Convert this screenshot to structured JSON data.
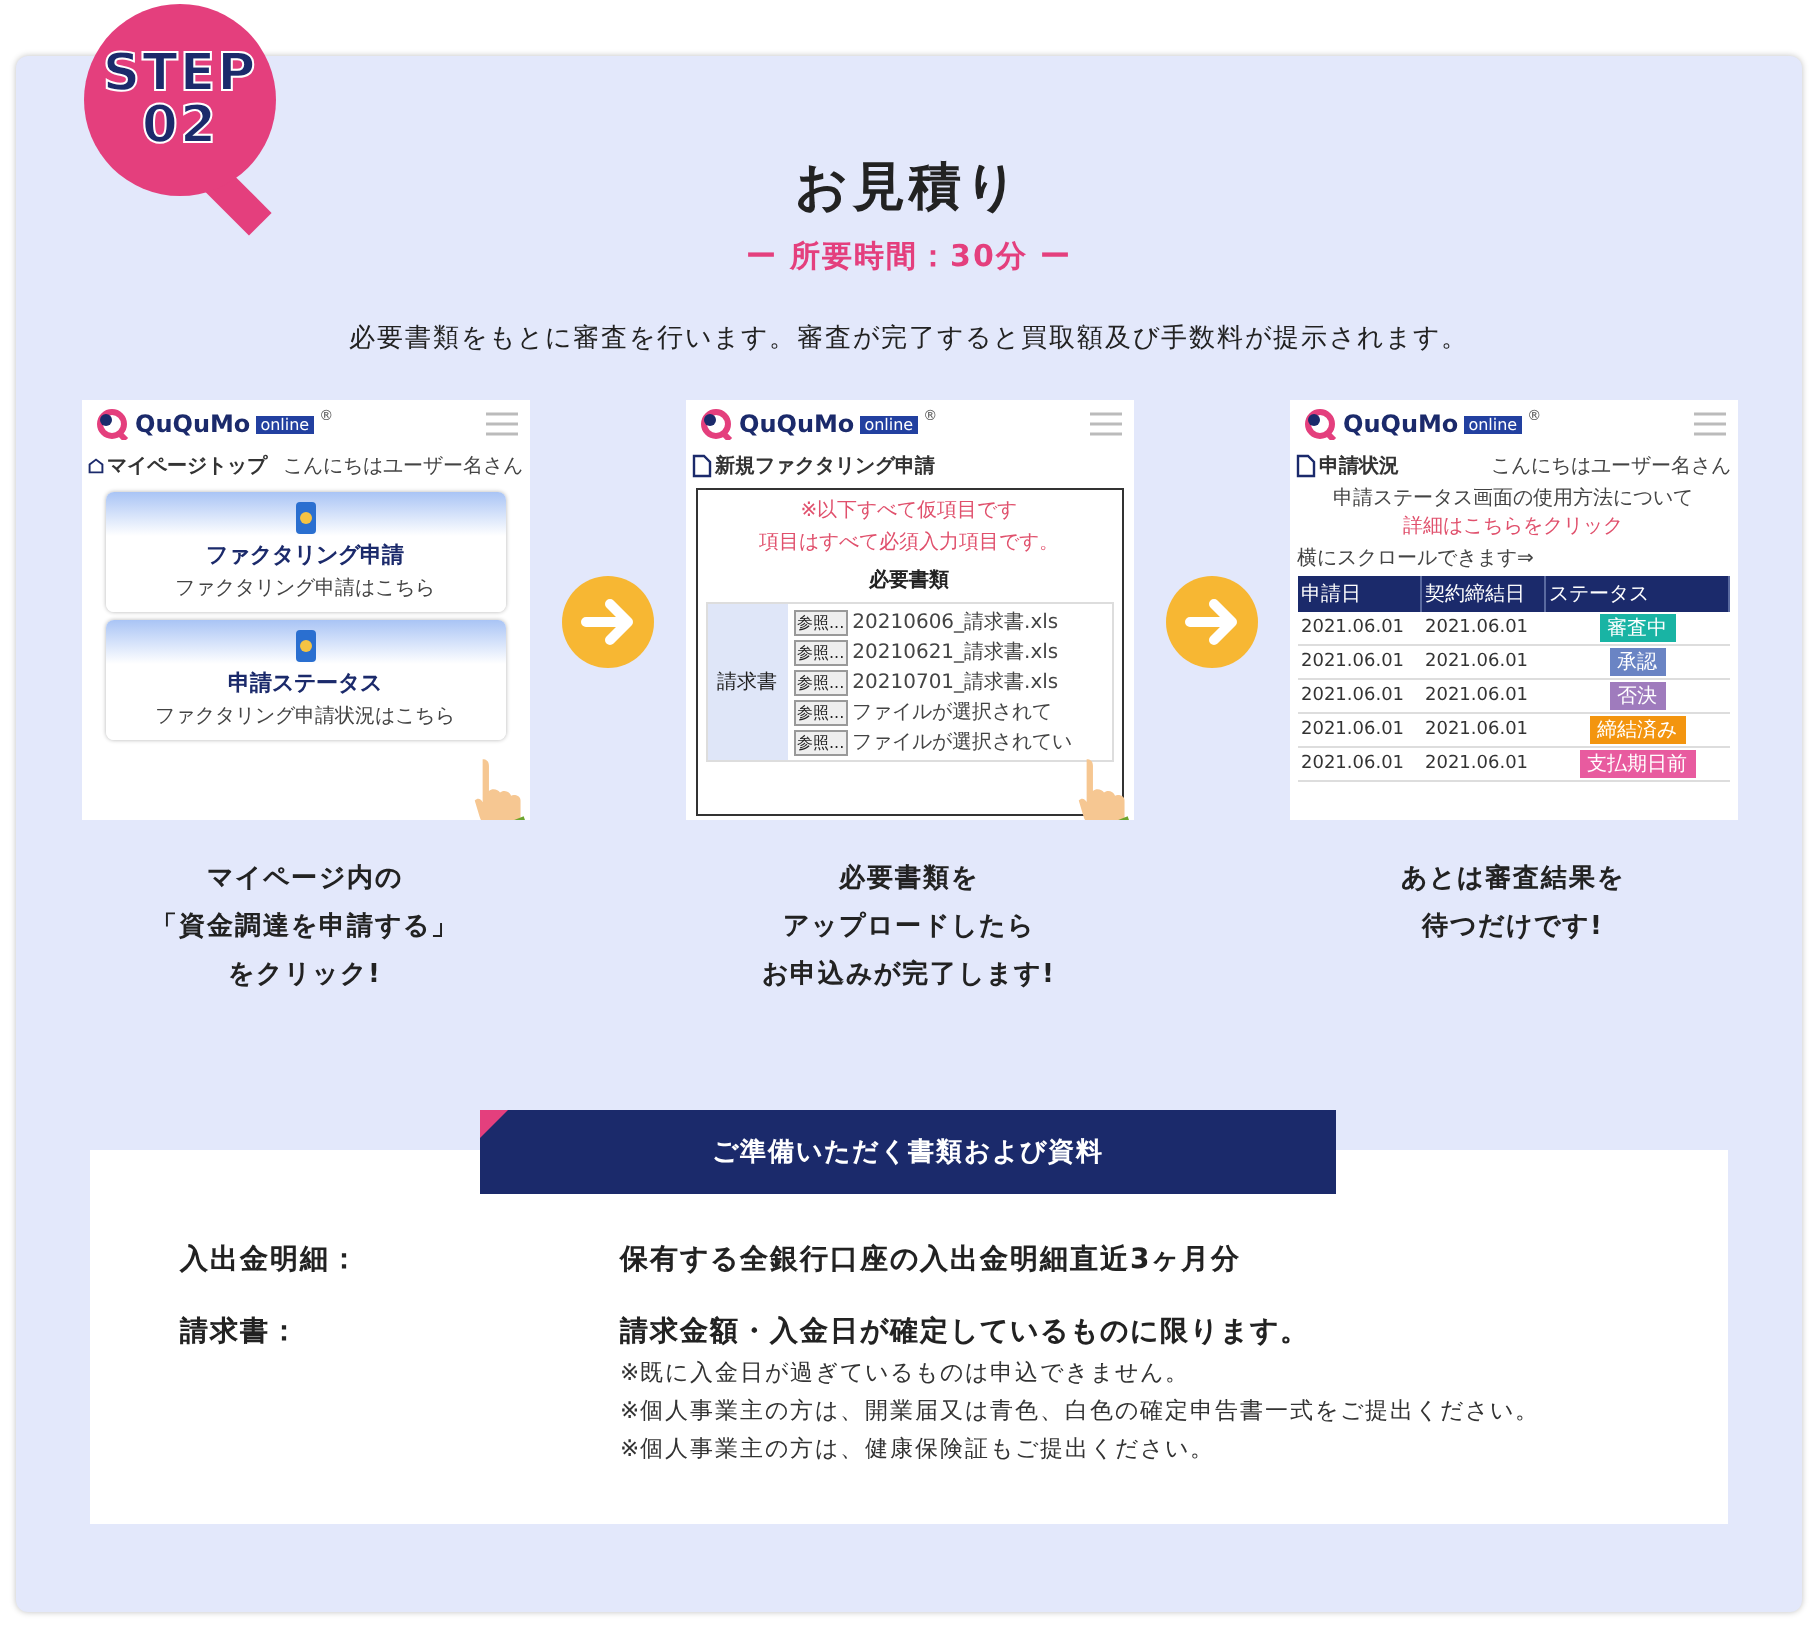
{
  "step_badge": {
    "label": "STEP",
    "number": "02"
  },
  "title": "お見積り",
  "duration": "ー 所要時間：30分 ー",
  "intro": "必要書類をもとに審査を行います。審査が完了すると買取額及び手数料が提示されます。",
  "steps": [
    {
      "screen": {
        "kind": "mypage",
        "brand": "QuQuMo",
        "reg": "®",
        "badge": "online",
        "page_title": "マイページトップ",
        "greeting": "こんにちはユーザー名さん",
        "cards": [
          {
            "title": "ファクタリング申請",
            "link": "ファクタリング申請はこちら"
          },
          {
            "title": "申請ステータス",
            "link": "ファクタリング申請状況はこちら"
          }
        ]
      },
      "caption": [
        "マイページ内の",
        "「資金調達を申請する」",
        "をクリック!"
      ]
    },
    {
      "screen": {
        "kind": "upload",
        "brand": "QuQuMo",
        "reg": "®",
        "badge": "online",
        "page_title": "新規ファクタリング申請",
        "notice": "※以下すべて仮項目です",
        "note": "項目はすべて必須入力項目です。",
        "section": "必要書類",
        "row_label": "請求書",
        "files": [
          {
            "button": "参照...",
            "name": "20210606_請求書.xls"
          },
          {
            "button": "参照...",
            "name": "20210621_請求書.xls"
          },
          {
            "button": "参照...",
            "name": "20210701_請求書.xls"
          },
          {
            "button": "参照...",
            "name": "ファイルが選択されて"
          },
          {
            "button": "参照...",
            "name": "ファイルが選択されてい"
          }
        ]
      },
      "caption": [
        "必要書類を",
        "アップロードしたら",
        "お申込みが完了します!"
      ]
    },
    {
      "screen": {
        "kind": "status",
        "brand": "QuQuMo",
        "reg": "®",
        "badge": "online",
        "page_title": "申請状況",
        "greeting": "こんにちはユーザー名さん",
        "help": "申請ステータス画面の使用方法について",
        "help_link": "詳細はこちらをクリック",
        "scroll_hint": "横にスクロールできます⇒",
        "columns": [
          "申請日",
          "契約締結日",
          "ステータス"
        ],
        "rows": [
          {
            "applied": "2021.06.01",
            "contracted": "2021.06.01",
            "status": "審査中",
            "color": "#19b4a4"
          },
          {
            "applied": "2021.06.01",
            "contracted": "2021.06.01",
            "status": "承認",
            "color": "#6a84c4"
          },
          {
            "applied": "2021.06.01",
            "contracted": "2021.06.01",
            "status": "否決",
            "color": "#9f7bbd"
          },
          {
            "applied": "2021.06.01",
            "contracted": "2021.06.01",
            "status": "締結済み",
            "color": "#f3950f"
          },
          {
            "applied": "2021.06.01",
            "contracted": "2021.06.01",
            "status": "支払期日前",
            "color": "#e85b9f"
          }
        ]
      },
      "caption": [
        "あとは審査結果を",
        "待つだけです!"
      ]
    }
  ],
  "documents": {
    "heading": "ご準備いただく書類および資料",
    "items": [
      {
        "label": "入出金明細：",
        "text": "保有する全銀行口座の入出金明細直近3ヶ月分"
      },
      {
        "label": "請求書：",
        "text": "請求金額・入金日が確定しているものに限ります。",
        "notes": [
          "※既に入金日が過ぎているものは申込できません。",
          "※個人事業主の方は、開業届又は青色、白色の確定申告書一式をご提出ください。",
          "※個人事業主の方は、健康保険証もご提出ください。"
        ]
      }
    ]
  }
}
